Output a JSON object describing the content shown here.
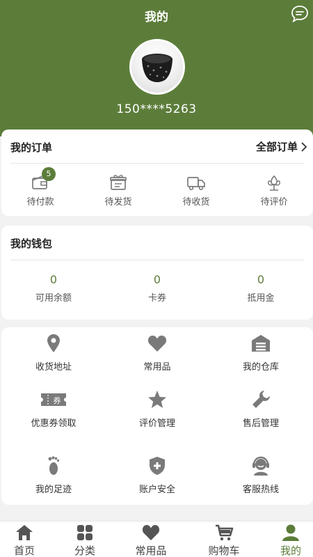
{
  "header": {
    "title": "我的",
    "phone": "150****5263"
  },
  "orders": {
    "title": "我的订单",
    "all_label": "全部订单",
    "items": [
      {
        "label": "待付款",
        "badge": "5",
        "icon": "wallet-icon"
      },
      {
        "label": "待发货",
        "icon": "gift-box-icon"
      },
      {
        "label": "待收货",
        "icon": "truck-icon"
      },
      {
        "label": "待评价",
        "icon": "flower-icon"
      }
    ]
  },
  "wallet": {
    "title": "我的钱包",
    "items": [
      {
        "value": "0",
        "label": "可用余额"
      },
      {
        "value": "0",
        "label": "卡券"
      },
      {
        "value": "0",
        "label": "抵用金"
      }
    ]
  },
  "tools": [
    {
      "label": "收货地址",
      "icon": "location-pin-icon"
    },
    {
      "label": "常用品",
      "icon": "heart-icon"
    },
    {
      "label": "我的仓库",
      "icon": "warehouse-icon"
    },
    {
      "label": "优惠券领取",
      "icon": "coupon-icon",
      "icon_text": "券"
    },
    {
      "label": "评价管理",
      "icon": "star-icon"
    },
    {
      "label": "售后管理",
      "icon": "wrench-icon"
    },
    {
      "label": "我的足迹",
      "icon": "footprint-icon"
    },
    {
      "label": "账户安全",
      "icon": "shield-icon"
    },
    {
      "label": "客服热线",
      "icon": "customer-service-icon"
    }
  ],
  "tabbar": [
    {
      "label": "首页",
      "icon": "home-icon"
    },
    {
      "label": "分类",
      "icon": "grid-icon"
    },
    {
      "label": "常用品",
      "icon": "heart-icon"
    },
    {
      "label": "购物车",
      "icon": "cart-icon"
    },
    {
      "label": "我的",
      "icon": "user-icon",
      "active": true
    }
  ],
  "colors": {
    "brand": "#5c7d3a",
    "icon_gray": "#7a7a7a",
    "background": "#f2f2f2"
  }
}
